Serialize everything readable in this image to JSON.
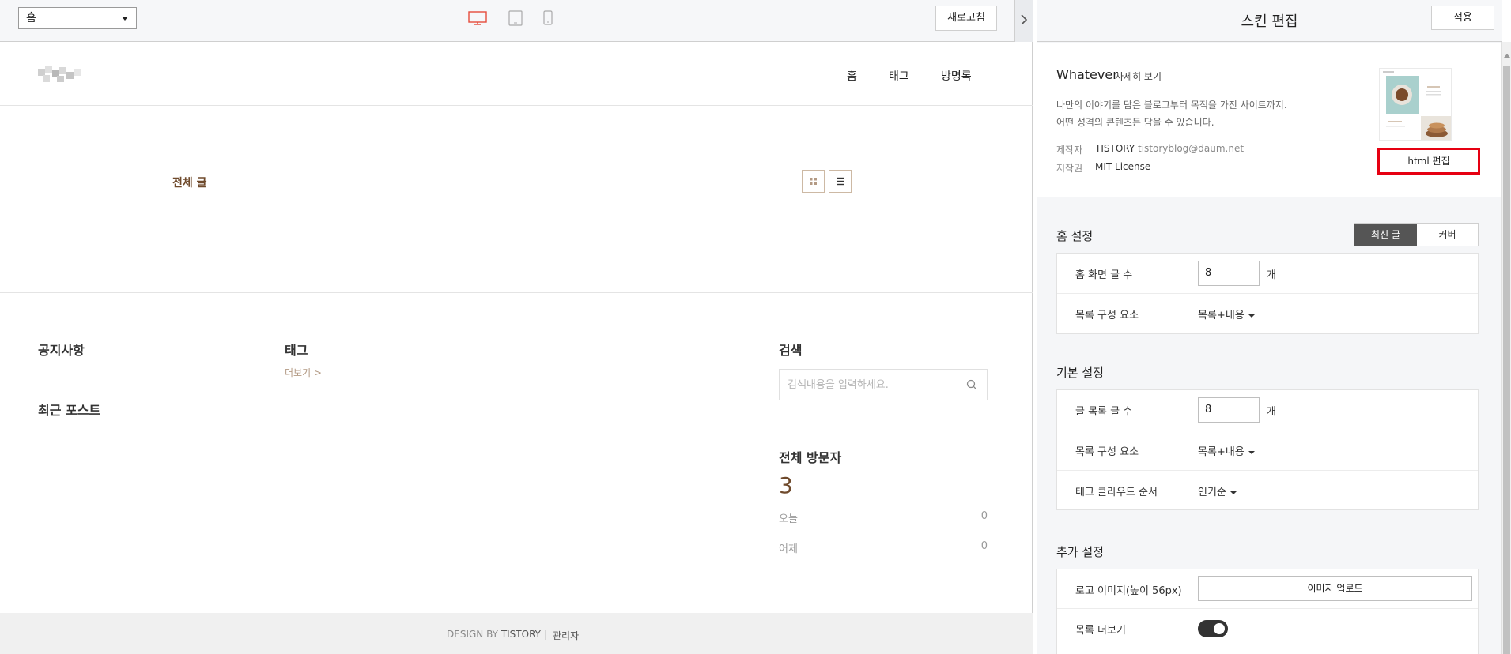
{
  "toolbar": {
    "page_select": "홈",
    "refresh_label": "새로고침",
    "icons": [
      "desktop-icon",
      "tablet-icon",
      "mobile-icon",
      "chevron-right-icon"
    ],
    "accent": "#e64c3c"
  },
  "blog": {
    "nav": {
      "home": "홈",
      "tag": "태그",
      "guestbook": "방명록"
    },
    "all_posts": "전체 글",
    "notice": "공지사항",
    "recent": "최근 포스트",
    "tag": "태그",
    "tag_more": "더보기 >",
    "search": {
      "title": "검색",
      "placeholder": "검색내용을 입력하세요."
    },
    "visitors": {
      "title": "전체 방문자",
      "total": "3",
      "today_label": "오늘",
      "today_value": "0",
      "yesterday_label": "어제",
      "yesterday_value": "0"
    },
    "footer": {
      "design_prefix": "DESIGN BY",
      "design_brand": "TISTORY",
      "separator": "|",
      "admin": "관리자"
    },
    "accent": "#6f4a2c"
  },
  "panel": {
    "title": "스킨 편집",
    "apply_label": "적용",
    "skin": {
      "name": "Whatever",
      "detail_link": "자세히 보기",
      "desc1": "나만의 이야기를 담은 블로그부터 목적을 가진 사이트까지.",
      "desc2": "어떤 성격의 콘텐츠든 담을 수 있습니다.",
      "maker_label": "제작자",
      "maker_name": "TISTORY",
      "maker_email": "tistoryblog@daum.net",
      "license_label": "저작권",
      "license_value": "MIT License",
      "html_edit_label": "html 편집"
    },
    "home_settings": {
      "title": "홈 설정",
      "toggle": [
        "최신 글",
        "커버"
      ],
      "post_count_label": "홈 화면 글 수",
      "post_count_value": "8",
      "unit": "개",
      "list_elements_label": "목록 구성 요소",
      "list_elements_value": "목록+내용"
    },
    "basic_settings": {
      "title": "기본 설정",
      "post_count_label": "글 목록 글 수",
      "post_count_value": "8",
      "unit": "개",
      "list_elements_label": "목록 구성 요소",
      "list_elements_value": "목록+내용",
      "tag_cloud_label": "태그 클라우드 순서",
      "tag_cloud_value": "인기순"
    },
    "extra_settings": {
      "title": "추가 설정",
      "logo_label": "로고 이미지(높이 56px)",
      "upload_label": "이미지 업로드",
      "more_label": "목록 더보기",
      "more_enabled": true
    },
    "highlight_color": "#e60012"
  }
}
